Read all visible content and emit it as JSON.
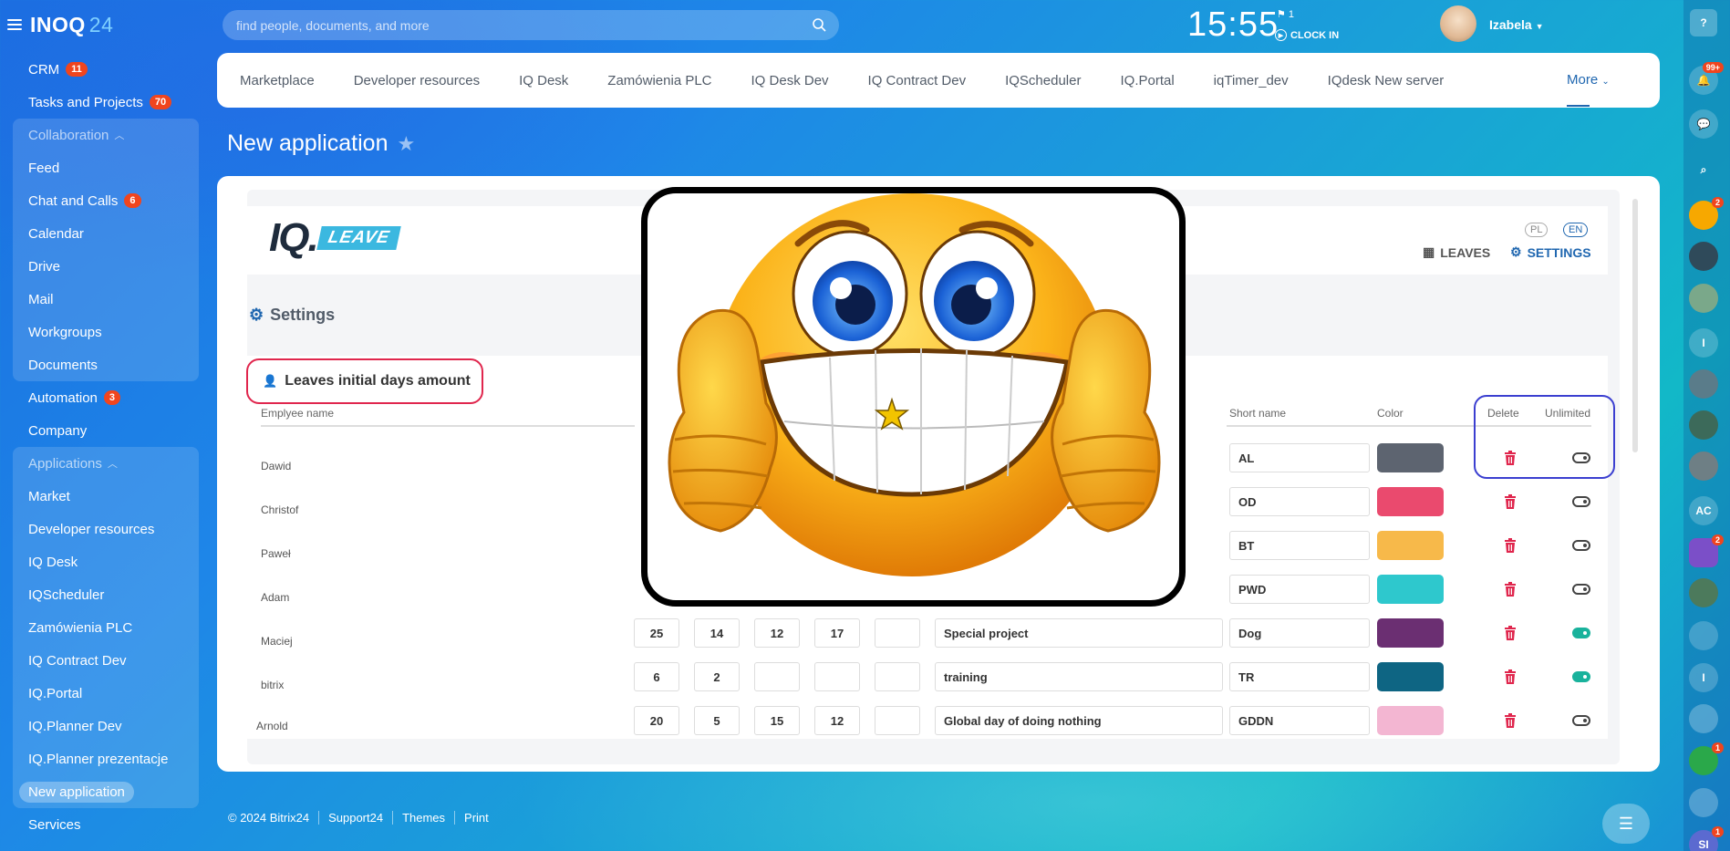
{
  "app": {
    "logo": "INOQ",
    "logo_num": "24"
  },
  "search": {
    "placeholder": "find people, documents, and more"
  },
  "clock": {
    "time": "15:55",
    "flag_count": "1",
    "clock_in": "CLOCK IN"
  },
  "user": {
    "name": "Izabela"
  },
  "sidebar": {
    "top": [
      {
        "label": "CRM",
        "badge": "11"
      },
      {
        "label": "Tasks and Projects",
        "badge": "70"
      }
    ],
    "collab_title": "Collaboration",
    "collab": [
      {
        "label": "Feed"
      },
      {
        "label": "Chat and Calls",
        "badge": "6"
      },
      {
        "label": "Calendar"
      },
      {
        "label": "Drive"
      },
      {
        "label": "Mail"
      },
      {
        "label": "Workgroups"
      },
      {
        "label": "Documents"
      }
    ],
    "mid": [
      {
        "label": "Automation",
        "badge": "3"
      },
      {
        "label": "Company"
      }
    ],
    "apps_title": "Applications",
    "apps": [
      {
        "label": "Market"
      },
      {
        "label": "Developer resources"
      },
      {
        "label": "IQ Desk"
      },
      {
        "label": "IQScheduler"
      },
      {
        "label": "Zamówienia PLC"
      },
      {
        "label": "IQ Contract Dev"
      },
      {
        "label": "IQ.Portal"
      },
      {
        "label": "IQ.Planner Dev"
      },
      {
        "label": "IQ.Planner prezentacje"
      },
      {
        "label": "New application"
      }
    ],
    "bottom": [
      {
        "label": "Services"
      }
    ]
  },
  "tabs": [
    "Marketplace",
    "Developer resources",
    "IQ Desk",
    "Zamówienia PLC",
    "IQ Desk Dev",
    "IQ Contract Dev",
    "IQScheduler",
    "IQ.Portal",
    "iqTimer_dev",
    "IQdesk New server"
  ],
  "tabs_more": "More",
  "page": {
    "title": "New application"
  },
  "leave_app": {
    "logo_iq": "IQ.",
    "logo_leave": "LEAVE",
    "lang_pl": "PL",
    "lang_en": "EN",
    "leaves_link": "LEAVES",
    "settings_link": "SETTINGS",
    "settings_title": "Settings",
    "section_title": "Leaves initial days amount",
    "col_employee": "Emplyee name",
    "col_short": "Short name",
    "col_color": "Color",
    "col_delete": "Delete",
    "col_unlimited": "Unlimited",
    "employees": [
      "Dawid",
      "Christof",
      "Paweł",
      "Adam",
      "Maciej",
      "bitrix",
      "Arnold"
    ],
    "types": [
      {
        "short": "AL",
        "color": "#5d6470",
        "unlimited": false
      },
      {
        "short": "OD",
        "color": "#ea4a6e",
        "unlimited": false
      },
      {
        "short": "BT",
        "color": "#f7b94a",
        "unlimited": false
      },
      {
        "short": "PWD",
        "color": "#2ec8cd",
        "unlimited": false
      },
      {
        "short": "Dog",
        "name": "Special project",
        "color": "#6b2f72",
        "days": [
          "25",
          "14",
          "12",
          "17",
          ""
        ],
        "unlimited": true
      },
      {
        "short": "TR",
        "name": "training",
        "color": "#0e6583",
        "days": [
          "6",
          "2",
          "",
          "",
          ""
        ],
        "unlimited": true
      },
      {
        "short": "GDDN",
        "name": "Global day of doing nothing",
        "color": "#f3b6d2",
        "days": [
          "20",
          "5",
          "15",
          "12",
          ""
        ],
        "unlimited": false
      }
    ]
  },
  "footer": {
    "copyright": "© 2024 Bitrix24",
    "support": "Support24",
    "themes": "Themes",
    "print": "Print"
  },
  "rightbar": {
    "help": "?",
    "notif_count": "99+",
    "ac": "AC",
    "i": "I",
    "si": "SI"
  }
}
